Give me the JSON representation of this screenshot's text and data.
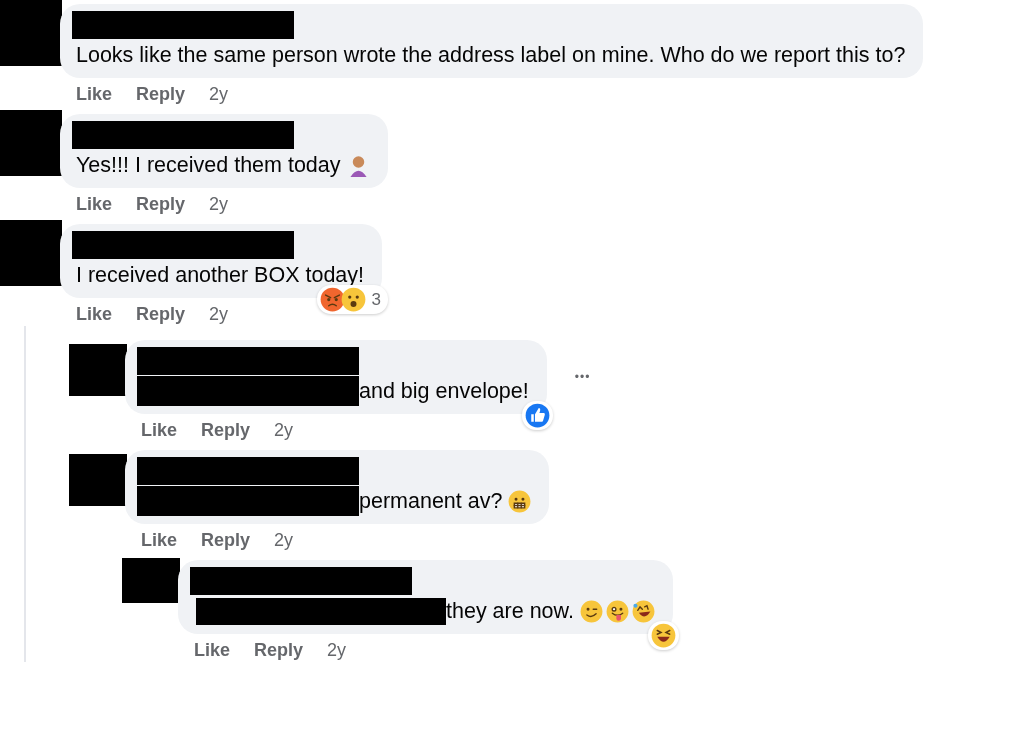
{
  "comments": [
    {
      "name_redacted": true,
      "text": "Looks like the same person wrote the address label on mine. Who do we report this to?",
      "actions": [
        "Like",
        "Reply"
      ],
      "time": "2y"
    },
    {
      "name_redacted": true,
      "text": "Yes!!! I received them today",
      "emoji": [
        {
          "kind": "facepalm"
        }
      ],
      "actions": [
        "Like",
        "Reply"
      ],
      "time": "2y"
    },
    {
      "name_redacted": true,
      "text": "I received another BOX today!",
      "reactions": {
        "icons": [
          {
            "kind": "angry"
          },
          {
            "kind": "wow"
          }
        ],
        "count": "3"
      },
      "actions": [
        "Like",
        "Reply"
      ],
      "time": "2y",
      "children": [
        {
          "name_redacted": true,
          "prefix_redacted": true,
          "text": "and big envelope!",
          "reactions": {
            "icons": [
              {
                "kind": "like"
              }
            ]
          },
          "menu": "•••",
          "actions": [
            "Like",
            "Reply"
          ],
          "time": "2y"
        },
        {
          "name_redacted": true,
          "prefix_redacted": true,
          "text": "permanent av?",
          "emoji": [
            {
              "kind": "grimace"
            }
          ],
          "actions": [
            "Like",
            "Reply"
          ],
          "time": "2y",
          "children": [
            {
              "name_redacted": true,
              "prefix_redacted": true,
              "text": "they are now.",
              "emoji": [
                {
                  "kind": "wink"
                },
                {
                  "kind": "tongue"
                },
                {
                  "kind": "rofl"
                }
              ],
              "reactions": {
                "icons": [
                  {
                    "kind": "haha"
                  }
                ]
              },
              "actions": [
                "Like",
                "Reply"
              ],
              "time": "2y"
            }
          ]
        }
      ]
    }
  ]
}
